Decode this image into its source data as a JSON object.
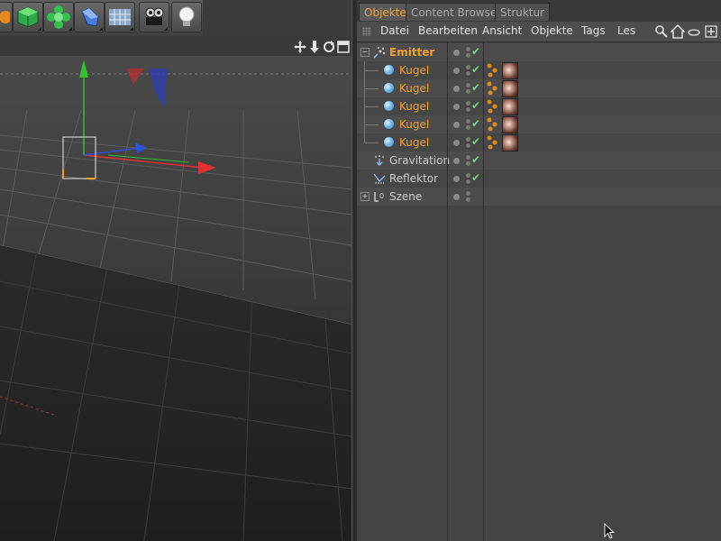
{
  "toolbar": {
    "buttons": [
      {
        "icon": "cube-icon"
      },
      {
        "icon": "cloner-icon"
      },
      {
        "icon": "deformer-icon"
      },
      {
        "icon": "floor-icon"
      },
      {
        "icon": "camera-icon"
      },
      {
        "icon": "light-icon"
      }
    ]
  },
  "viewport": {
    "nav_icons": [
      "move-view-icon",
      "zoom-view-icon",
      "rotate-view-icon",
      "maximize-view-icon"
    ]
  },
  "object_manager": {
    "tabs": [
      "Objekte",
      "Content Browser",
      "Struktur"
    ],
    "active_tab": "Objekte",
    "menu": [
      "Datei",
      "Bearbeiten",
      "Ansicht",
      "Objekte",
      "Tags",
      "Lese"
    ],
    "menu_icons": [
      "search-icon",
      "home-icon",
      "layer-icon",
      "new-window-icon"
    ],
    "objects": [
      {
        "name": "Emitter",
        "type": "emitter",
        "level": 0,
        "selected": true,
        "color": "#f0a030"
      },
      {
        "name": "Kugel",
        "type": "sphere",
        "level": 1,
        "selected": true
      },
      {
        "name": "Kugel",
        "type": "sphere",
        "level": 1,
        "selected": true
      },
      {
        "name": "Kugel",
        "type": "sphere",
        "level": 1,
        "selected": true
      },
      {
        "name": "Kugel",
        "type": "sphere",
        "level": 1,
        "selected": true
      },
      {
        "name": "Kugel",
        "type": "sphere",
        "level": 1,
        "selected": true
      },
      {
        "name": "Gravitation",
        "type": "gravity",
        "level": 0,
        "selected": false
      },
      {
        "name": "Reflektor",
        "type": "reflector",
        "level": 0,
        "selected": false
      },
      {
        "name": "Szene",
        "type": "null",
        "level": 0,
        "selected": false
      }
    ]
  },
  "colors": {
    "accent": "#f0a030",
    "check": "#7fd07f",
    "axis_x": "#e03030",
    "axis_y": "#30c030",
    "axis_z": "#3050e0"
  }
}
